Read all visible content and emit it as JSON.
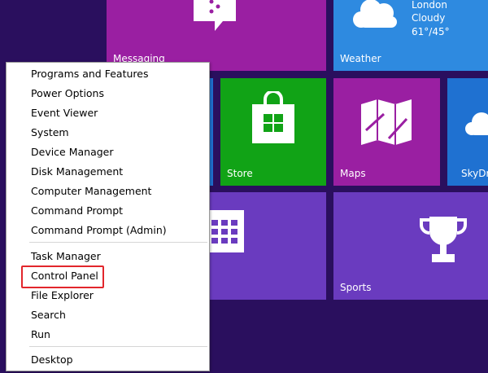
{
  "tiles": {
    "messaging": {
      "label": "Messaging",
      "color": "#9a1fa2"
    },
    "weather": {
      "label": "Weather",
      "city": "London",
      "condition": "Cloudy",
      "temps": "61°/45°",
      "color": "#2e8ae0"
    },
    "store": {
      "label": "Store",
      "color": "#11a316"
    },
    "maps": {
      "label": "Maps",
      "color": "#9a1fa2"
    },
    "skydrive": {
      "label": "SkyDri",
      "color": "#1f71d1"
    },
    "sports": {
      "label": "Sports",
      "color": "#6a3bbf"
    }
  },
  "menu": {
    "items": [
      "Programs and Features",
      "Power Options",
      "Event Viewer",
      "System",
      "Device Manager",
      "Disk Management",
      "Computer Management",
      "Command Prompt",
      "Command Prompt (Admin)",
      "Task Manager",
      "Control Panel",
      "File Explorer",
      "Search",
      "Run",
      "Desktop"
    ],
    "highlighted_item": "Control Panel",
    "highlight_color": "#e2262c"
  }
}
